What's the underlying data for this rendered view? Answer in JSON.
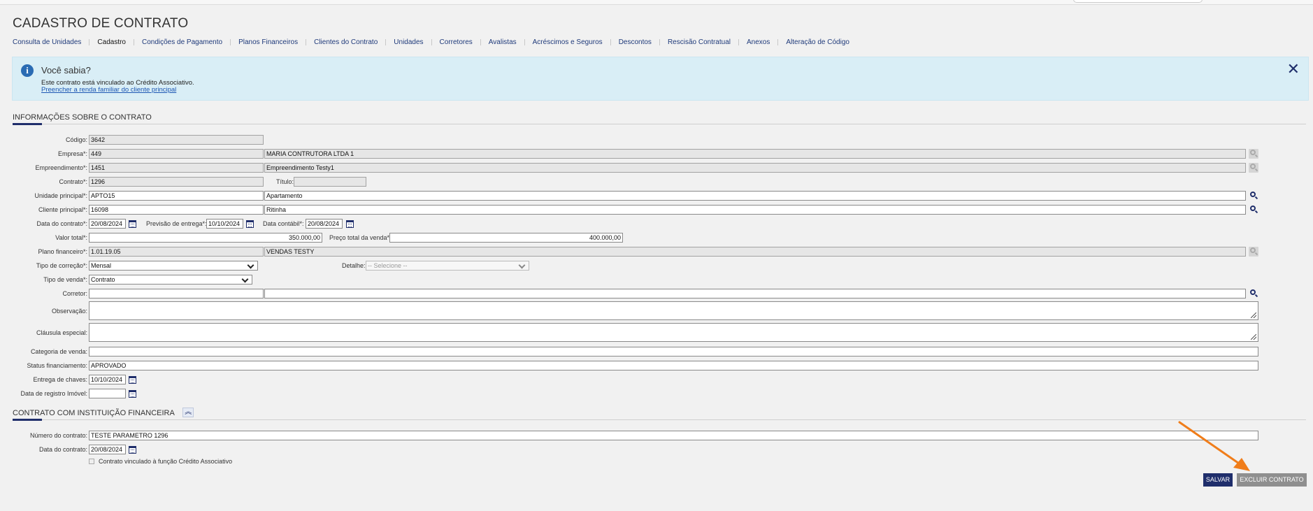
{
  "page": {
    "title": "CADASTRO DE CONTRATO"
  },
  "tabs": [
    {
      "label": "Consulta de Unidades"
    },
    {
      "label": "Cadastro"
    },
    {
      "label": "Condições de Pagamento"
    },
    {
      "label": "Planos Financeiros"
    },
    {
      "label": "Clientes do Contrato"
    },
    {
      "label": "Unidades"
    },
    {
      "label": "Corretores"
    },
    {
      "label": "Avalistas"
    },
    {
      "label": "Acréscimos e Seguros"
    },
    {
      "label": "Descontos"
    },
    {
      "label": "Rescisão Contratual"
    },
    {
      "label": "Anexos"
    },
    {
      "label": "Alteração de Código"
    }
  ],
  "alert": {
    "icon": "info-icon",
    "title": "Você sabia?",
    "message": "Este contrato está vinculado ao Crédito Associativo.",
    "link": "Preencher a renda familiar do cliente principal",
    "close": "✕"
  },
  "section_info": {
    "title": "INFORMAÇÕES SOBRE O CONTRATO"
  },
  "form": {
    "codigo": {
      "label": "Código:",
      "value": "3642"
    },
    "empresa": {
      "label": "Empresa*:",
      "code": "449",
      "name": "MARIA CONTRUTORA LTDA 1"
    },
    "empreendimento": {
      "label": "Empreendimento*:",
      "code": "1451",
      "name": "Empreendimento Testy1"
    },
    "contrato": {
      "label": "Contrato*:",
      "value": "1296",
      "titulo_label": "Título:",
      "titulo_value": ""
    },
    "unidade": {
      "label": "Unidade principal*:",
      "code": "APTO15",
      "name": "Apartamento"
    },
    "cliente": {
      "label": "Cliente principal*:",
      "code": "16098",
      "name": "Ritinha"
    },
    "datas": {
      "contrato_label": "Data do contrato*:",
      "contrato_value": "20/08/2024",
      "entrega_label": "Previsão de entrega*:",
      "entrega_value": "10/10/2024",
      "contabil_label": "Data contábil*:",
      "contabil_value": "20/08/2024"
    },
    "valores": {
      "total_label": "Valor total*:",
      "total_value": "350.000,00",
      "preco_label": "Preço total da venda*:",
      "preco_value": "400.000,00"
    },
    "plano": {
      "label": "Plano financeiro*:",
      "code": "1.01.19.05",
      "name": "VENDAS TESTY"
    },
    "correcao": {
      "label": "Tipo de correção*:",
      "value": "Mensal",
      "detalhe_label": "Detalhe:",
      "detalhe_value": "-- Selecione --"
    },
    "tipo_venda": {
      "label": "Tipo de venda*:",
      "value": "Contrato"
    },
    "corretor": {
      "label": "Corretor:",
      "code": "",
      "name": ""
    },
    "observacao": {
      "label": "Observação:",
      "value": ""
    },
    "clausula": {
      "label": "Cláusula especial:",
      "value": ""
    },
    "categoria": {
      "label": "Categoria de venda:",
      "value": ""
    },
    "status_fin": {
      "label": "Status financiamento:",
      "value": "APROVADO"
    },
    "entrega_chaves": {
      "label": "Entrega de chaves:",
      "value": "10/10/2024"
    },
    "registro_imovel": {
      "label": "Data de registro Imóvel:",
      "value": ""
    }
  },
  "section_fin": {
    "title": "CONTRATO COM INSTITUIÇÃO FINANCEIRA",
    "toggle": "︽"
  },
  "fin": {
    "numero": {
      "label": "Número do contrato:",
      "value": "TESTE PARAMETRO 1296"
    },
    "data": {
      "label": "Data do contrato:",
      "value": "20/08/2024"
    },
    "credito": {
      "label": "Contrato vinculado à função Crédito Associativo",
      "checked": false
    }
  },
  "actions": {
    "save": "SALVAR",
    "delete": "EXCLUIR CONTRATO"
  },
  "colors": {
    "primary": "#1f2e6b",
    "alert_bg": "#d9eef6",
    "arrow": "#f07d1a",
    "delete_btn": "#8f8f8f"
  }
}
